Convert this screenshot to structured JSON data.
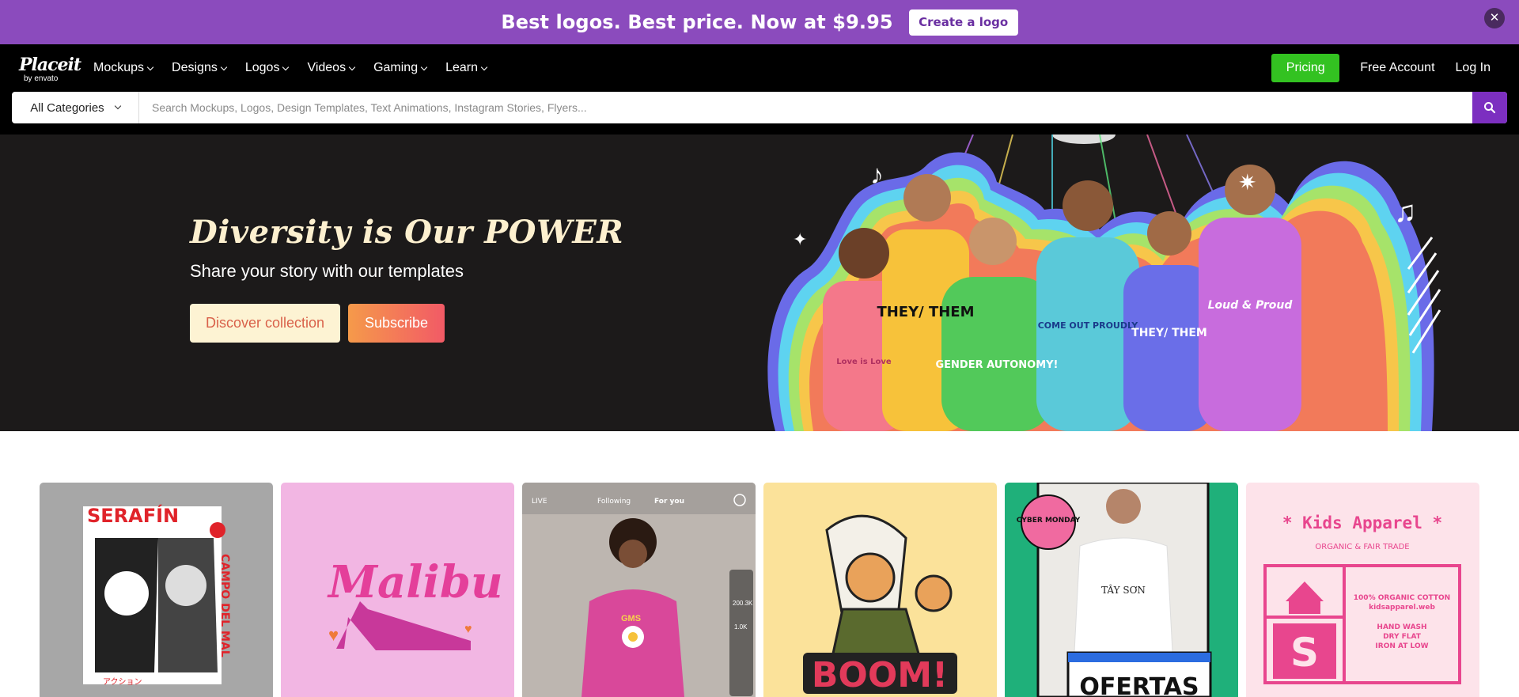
{
  "promo": {
    "text": "Best logos. Best price. Now at $9.95",
    "cta": "Create a logo",
    "close_icon": "close-icon"
  },
  "nav": {
    "logo_main": "Placeit",
    "logo_sub": "by envato",
    "menu": [
      "Mockups",
      "Designs",
      "Logos",
      "Videos",
      "Gaming",
      "Learn"
    ],
    "pricing": "Pricing",
    "free_account": "Free Account",
    "login": "Log In"
  },
  "search": {
    "category": "All Categories",
    "placeholder": "Search Mockups, Logos, Design Templates, Text Animations, Instagram Stories, Flyers...",
    "button_icon": "search-icon"
  },
  "hero": {
    "title": "Diversity is Our POWER",
    "subtitle": "Share your story with our templates",
    "discover_label": "Discover collection",
    "subscribe_label": "Subscribe",
    "shirt_texts": [
      "THEY/ THEM",
      "GENDER AUTONOMY!",
      "COME OUT PROUDLY",
      "THEY/ THEM",
      "Loud & Proud",
      "Love is Love"
    ]
  },
  "cards": [
    {
      "text": "SERAFÍN",
      "vertical": "CAMPO DEL MAL",
      "caption": "アクション"
    },
    {
      "text": "Malibu"
    },
    {
      "tabs": [
        "Following",
        "For you"
      ],
      "live": "LIVE",
      "shirt": "GMS",
      "likes": "200.3K",
      "comments": "1.0K"
    },
    {
      "text": "BOOM!"
    },
    {
      "badge": "CYBER MONDAY",
      "shirt": "TÂY SƠN",
      "bottom": "OFERTAS"
    },
    {
      "title": "* Kids Apparel *",
      "subtitle": "ORGANIC & FAIR TRADE",
      "lines": [
        "100% ORGANIC COTTON",
        "kidsapparel.web",
        "HAND WASH",
        "DRY FLAT",
        "IRON AT LOW"
      ],
      "size": "S"
    }
  ],
  "colors": {
    "promo_bg": "#8b4bbd",
    "pricing_green": "#33c221",
    "search_purple": "#7c2fc0",
    "hero_bg": "#1c1a1a"
  }
}
